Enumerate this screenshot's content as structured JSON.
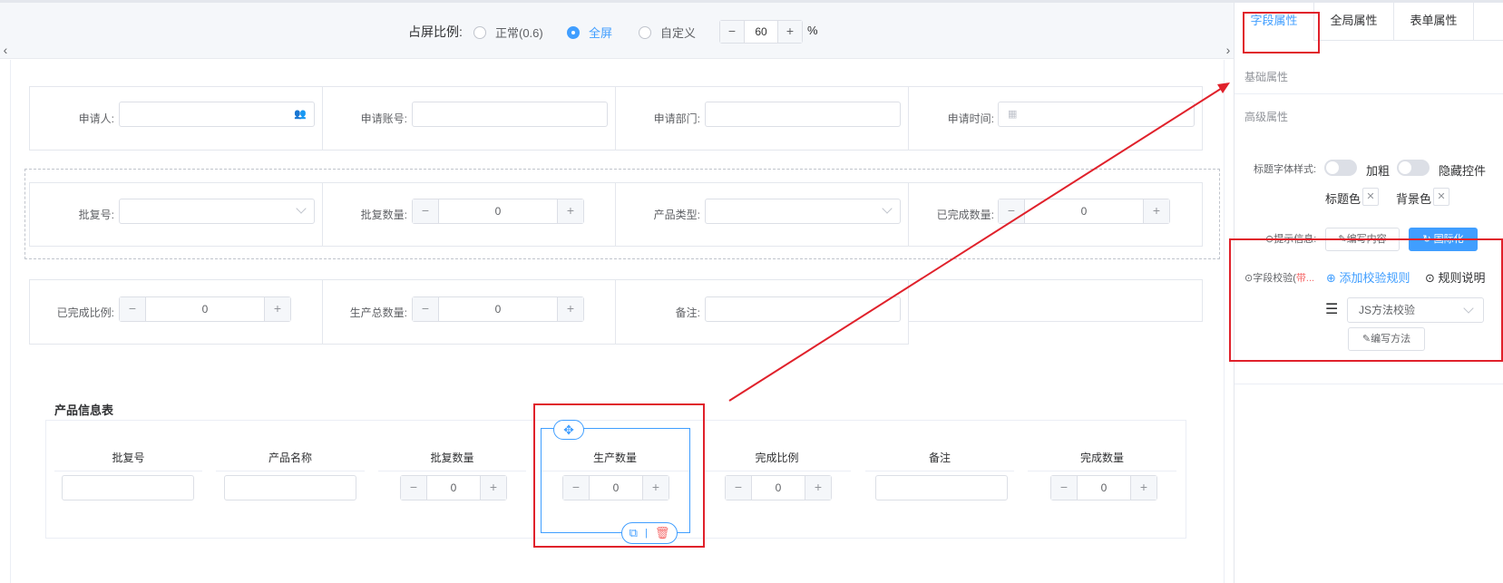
{
  "ratio": {
    "label": "占屏比例:",
    "options": [
      "正常(0.6)",
      "全屏",
      "自定义"
    ],
    "selected": "全屏",
    "custom_value": "60",
    "minus": "−",
    "plus": "+",
    "unit": "%"
  },
  "form": {
    "row1": [
      {
        "label": "申请人:",
        "type": "user-picker"
      },
      {
        "label": "申请账号:",
        "type": "text"
      },
      {
        "label": "申请部门:",
        "type": "text"
      },
      {
        "label": "申请时间:",
        "type": "date"
      }
    ],
    "row2": [
      {
        "label": "批复号:",
        "type": "select"
      },
      {
        "label": "批复数量:",
        "type": "number",
        "value": "0"
      },
      {
        "label": "产品类型:",
        "type": "select"
      },
      {
        "label": "已完成数量:",
        "type": "number",
        "value": "0"
      }
    ],
    "row3": [
      {
        "label": "已完成比例:",
        "type": "number",
        "value": "0"
      },
      {
        "label": "生产总数量:",
        "type": "number",
        "value": "0"
      },
      {
        "label": "备注:",
        "type": "text"
      }
    ]
  },
  "table": {
    "title": "产品信息表",
    "columns": [
      "批复号",
      "产品名称",
      "批复数量",
      "生产数量",
      "完成比例",
      "备注",
      "完成数量"
    ],
    "number_value": "0"
  },
  "panel": {
    "tabs": [
      "字段属性",
      "全局属性",
      "表单属性"
    ],
    "active_tab": "字段属性",
    "basic_title": "基础属性",
    "advanced_title": "高级属性",
    "title_font_style_label": "标题字体样式:",
    "bold_label": "加粗",
    "hide_label": "隐藏控件",
    "title_color_label": "标题色",
    "bg_color_label": "背景色",
    "hint_label": "⊙提示信息:",
    "write_content_btn": "✎编写内容",
    "internationalize_btn": "↻ 国际化",
    "validation_label_a": "⊙字段校验(",
    "validation_label_b": "带...",
    "add_rule_link": "⊕ 添加校验规则",
    "rule_desc_link": "⊙ 规则说明",
    "rule_type_value": "JS方法校验",
    "write_method_btn": "✎编写方法"
  },
  "icons": {
    "user": "user-icon",
    "calendar": "calendar-icon",
    "move": "move-icon",
    "copy": "copy-icon",
    "delete": "trash-icon",
    "drag": "drag-lines-icon"
  },
  "colors": {
    "accent": "#409eff",
    "annotation_red": "#e0212b",
    "danger": "#f56c6c"
  }
}
